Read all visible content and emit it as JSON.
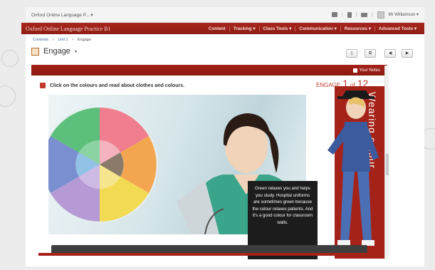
{
  "topbar": {
    "site_title": "Oxford Online Language P...  ▾",
    "user": "Mr Williamson ▾"
  },
  "nav": {
    "brand": "Oxford Online Language Practice B1",
    "items": [
      "Content",
      "Tracking ▾",
      "Class Tools ▾",
      "Communication ▾",
      "Resources ▾",
      "Advanced Tools ▾"
    ]
  },
  "breadcrumb": {
    "items": [
      "Contents",
      "Unit 1",
      "Engage"
    ]
  },
  "page": {
    "title": "Engage",
    "caret": "▾"
  },
  "toolbar": {
    "btn1": "▯",
    "btn2": "⧉",
    "prev": "◀",
    "next": "▶"
  },
  "panel": {
    "notes_label": "Your Notes",
    "instruction": "Click on the colours and read about clothes and colours.",
    "section": "ENGAGE",
    "current_page": "1",
    "of_label": "of",
    "total_pages": "12",
    "side_title": "Wearing colour",
    "tooltip": "Green relaxes you and helps you study. Hospital uniforms are sometimes green because the colour relaxes patients. And it's a good colour for classroom walls."
  },
  "colors": {
    "brand_red": "#a52219",
    "wheel": [
      "#5cbf7a",
      "#f07e8e",
      "#f3a64f",
      "#f2db52",
      "#b59ad6",
      "#7a8fd0",
      "#61a7dc"
    ]
  }
}
